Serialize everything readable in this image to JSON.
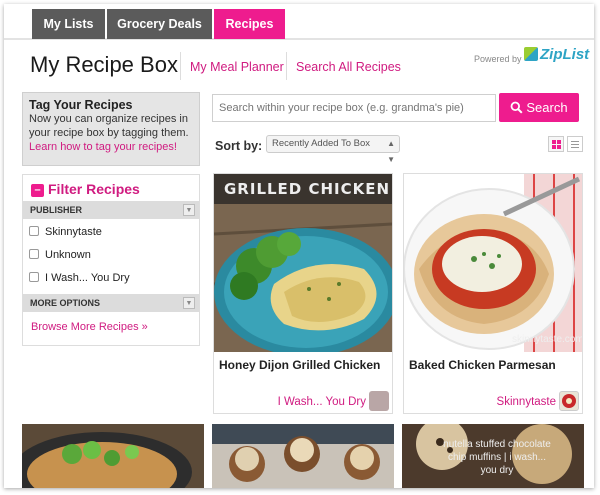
{
  "tabs": [
    {
      "label": "My Lists",
      "active": false
    },
    {
      "label": "Grocery Deals",
      "active": false
    },
    {
      "label": "Recipes",
      "active": true
    }
  ],
  "header": {
    "title": "My Recipe Box",
    "links": [
      "My Meal Planner",
      "Search All Recipes"
    ],
    "powered_by": "Powered by",
    "brand": "ZipList"
  },
  "tag_box": {
    "heading": "Tag Your Recipes",
    "body": "Now you can organize recipes in your recipe box by tagging them.",
    "link": "Learn how to tag your recipes!"
  },
  "filter": {
    "heading": "Filter Recipes",
    "sections": [
      {
        "label": "PUBLISHER",
        "options": [
          "Skinnytaste",
          "Unknown",
          "I Wash... You Dry"
        ]
      },
      {
        "label": "MORE OPTIONS",
        "options": []
      }
    ],
    "browse_link": "Browse More Recipes »"
  },
  "search": {
    "placeholder": "Search within your recipe box (e.g. grandma's pie)",
    "button": "Search",
    "icon": "search-icon"
  },
  "sort": {
    "label": "Sort by:",
    "selected": "Recently Added To Box"
  },
  "cards": [
    {
      "name": "Honey Dijon Grilled Chicken",
      "source": "I Wash... You Dry",
      "image_text": "GRILLED CHICKEN"
    },
    {
      "name": "Baked Chicken Parmesan",
      "source": "Skinnytaste",
      "image_text": "skinnytaste.com"
    }
  ],
  "bottom_images": [
    {
      "text": ""
    },
    {
      "text": ""
    },
    {
      "text": "nutella stuffed chocolate chip muffins | i wash... you dry"
    }
  ],
  "colors": {
    "accent": "#ee1c8e",
    "tab_dark": "#5b5b5b",
    "brand_blue": "#2ea4c5"
  }
}
